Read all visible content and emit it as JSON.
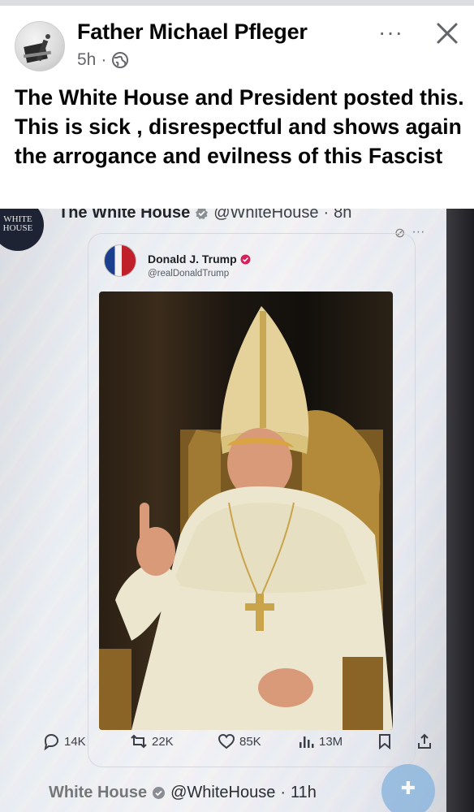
{
  "post": {
    "author": "Father Michael Pfleger",
    "time": "5h",
    "separator": "·",
    "more": "···",
    "text": "The White House and President posted this.  This is sick , disrespectful and shows again the arrogance and evilness of this Fascist"
  },
  "photo": {
    "badge_text": "WHITE HOUSE",
    "outer_tweet": {
      "name": "The White House",
      "handle": "@WhiteHouse",
      "time": "8h"
    },
    "quoted_tweet": {
      "name": "Donald J. Trump",
      "handle": "@realDonaldTrump"
    },
    "actions": {
      "replies": "14K",
      "reposts": "22K",
      "likes": "85K",
      "views": "13M"
    },
    "next_tweet": {
      "name": "White House",
      "handle": "@WhiteHouse",
      "time": "11h"
    }
  },
  "colors": {
    "text": "#050505",
    "muted": "#65676b",
    "verified_gray": "#8a8d93",
    "trump_badge": "#d2235c",
    "fab": "#8fb8de"
  }
}
